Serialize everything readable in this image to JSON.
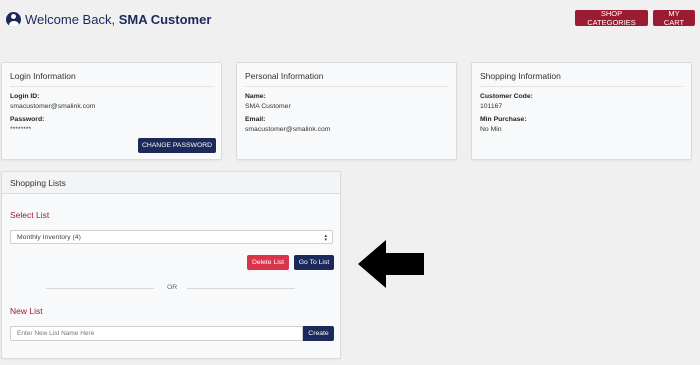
{
  "header": {
    "welcome_prefix": "Welcome Back,",
    "customer_name": "SMA Customer",
    "shop_categories_label": "SHOP CATEGORIES",
    "my_cart_label": "MY CART"
  },
  "login_info": {
    "title": "Login Information",
    "login_id_label": "Login ID:",
    "login_id_value": "smacustomer@smalink.com",
    "password_label": "Password:",
    "password_value": "********",
    "change_password_label": "CHANGE PASSWORD"
  },
  "personal_info": {
    "title": "Personal Information",
    "name_label": "Name:",
    "name_value": "SMA Customer",
    "email_label": "Email:",
    "email_value": "smacustomer@smalink.com"
  },
  "shopping_info": {
    "title": "Shopping Information",
    "customer_code_label": "Customer Code:",
    "customer_code_value": "101167",
    "min_purchase_label": "Min Purchase:",
    "min_purchase_value": "No Min"
  },
  "shopping_lists": {
    "title": "Shopping Lists",
    "select_list_label": "Select List",
    "selected_list": "Monthly Inventory (4)",
    "delete_list_label": "Delete List",
    "go_to_list_label": "Go To List",
    "or_text": "OR",
    "new_list_label": "New List",
    "new_list_placeholder": "Enter New List Name Here",
    "create_label": "Create"
  },
  "colors": {
    "brand_navy": "#1b2a5b",
    "brand_red": "#9b1b30",
    "delete_red": "#d9344a",
    "background": "#f0f0f0"
  },
  "icons": {
    "user": "user-circle-icon",
    "annotation_arrow": "left-arrow-icon"
  }
}
